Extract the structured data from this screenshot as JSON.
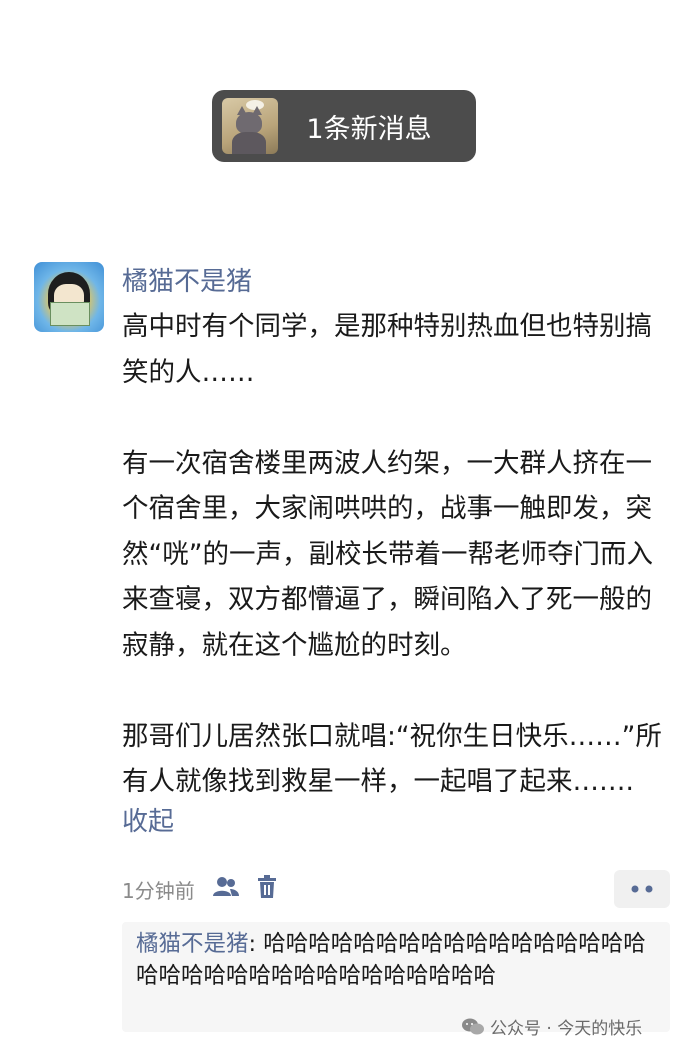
{
  "banner": {
    "text": "1条新消息"
  },
  "comment": {
    "nickname": "橘猫不是猪",
    "paragraphs": [
      "高中时有个同学，是那种特别热血但也特别搞笑的人……",
      "有一次宿舍楼里两波人约架，一大群人挤在一个宿舍里，大家闹哄哄的，战事一触即发，突然“咣”的一声，副校长带着一帮老师夺门而入来查寝，双方都懵逼了，瞬间陷入了死一般的寂静，就在这个尴尬的时刻。",
      "那哥们儿居然张口就唱:“祝你生日快乐……”所有人就像找到救星一样，一起唱了起来……."
    ],
    "collapse_label": "收起",
    "time": "1分钟前"
  },
  "reply": {
    "name": "橘猫不是猪",
    "separator": ": ",
    "text": "哈哈哈哈哈哈哈哈哈哈哈哈哈哈哈哈哈哈哈哈哈哈哈哈哈哈哈哈哈哈哈哈哈"
  },
  "watermark": {
    "text": "公众号 · 今天的快乐"
  },
  "colors": {
    "link": "#576b95",
    "banner_bg": "#4c4c4c",
    "reply_bg": "#f6f6f6"
  }
}
